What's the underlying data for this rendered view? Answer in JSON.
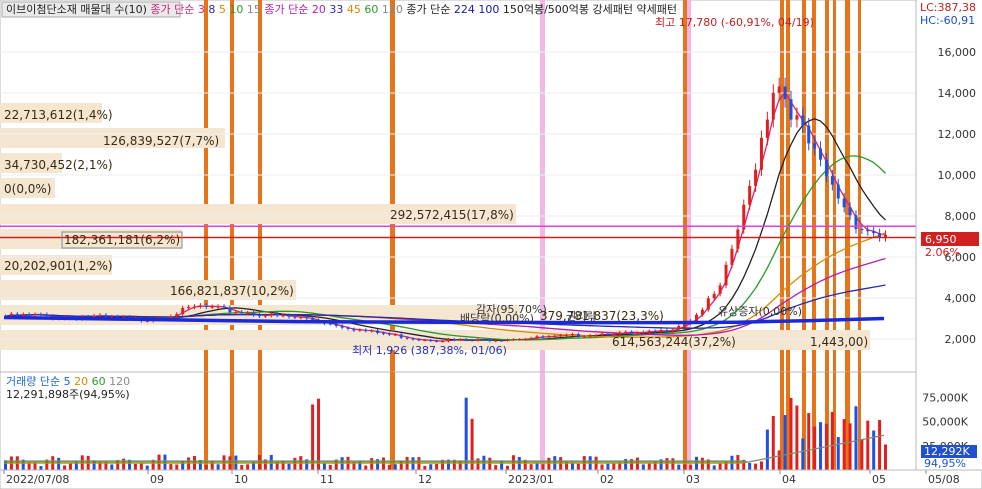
{
  "legend_price": [
    {
      "text": "이브이첨단소재 매물대 수(10)",
      "color": "#222222",
      "boxed": true
    },
    {
      "text": "종가 단순",
      "color": "#d4237a"
    },
    {
      "text": "3",
      "color": "#d4237a"
    },
    {
      "text": "8",
      "color": "#2a2aa8"
    },
    {
      "text": "5",
      "color": "#d88a00"
    },
    {
      "text": "10",
      "color": "#2a9a2a"
    },
    {
      "text": "15",
      "color": "#888888"
    },
    {
      "text": "종가 단순",
      "color": "#b020b0"
    },
    {
      "text": "20",
      "color": "#b020b0"
    },
    {
      "text": "33",
      "color": "#2a2aa8"
    },
    {
      "text": "45",
      "color": "#d88a00"
    },
    {
      "text": "60",
      "color": "#2a9a2a"
    },
    {
      "text": "120",
      "color": "#888888"
    },
    {
      "text": "종가 단순",
      "color": "#222222"
    },
    {
      "text": "224",
      "color": "#1a1aa0"
    },
    {
      "text": "100",
      "color": "#1a1aa0"
    },
    {
      "text": "150억봉/500억봉 강세패턴",
      "color": "#222222"
    },
    {
      "text": "약세패턴",
      "color": "#222222"
    }
  ],
  "legend_volume": [
    {
      "text": "거래량 단순",
      "color": "#1a6ad0"
    },
    {
      "text": "5",
      "color": "#1a6ad0"
    },
    {
      "text": "20",
      "color": "#d88a00"
    },
    {
      "text": "60",
      "color": "#2a9a2a"
    },
    {
      "text": "120",
      "color": "#888888"
    }
  ],
  "volume_readout": "12,291,898주(94,95%)",
  "top_right": {
    "lc": "LC:387,38",
    "hc": "HC:-60,91"
  },
  "current_price": {
    "value": 6950,
    "label": "6,950",
    "change": "2.06%"
  },
  "volume_current": {
    "label": "12,292K",
    "pct": "94,95%"
  },
  "colors": {
    "rise": "#e02020",
    "fall": "#2050e0",
    "ma224": "#1a2ad8",
    "highlight": "#e8741a",
    "highlight_pink": "#f0b8e6",
    "band": "#f5e6d2",
    "magenta_line": "#e040e0",
    "red_line": "#cc2020"
  },
  "chart_data": {
    "type": "candlestick",
    "x_ticks": [
      "2022/07/08",
      "09",
      "10",
      "11",
      "12",
      "2023/01",
      "02",
      "03",
      "04",
      "05",
      "05/08"
    ],
    "y_ticks": [
      2000,
      4000,
      6000,
      8000,
      10000,
      12000,
      14000,
      16000
    ],
    "y_tick_labels": [
      "2,000",
      "4,000",
      "6,000",
      "8,000",
      "10,000",
      "12,000",
      "14,000",
      "16,000"
    ],
    "volume_y_ticks": [
      25000,
      50000,
      75000
    ],
    "volume_y_tick_labels": [
      "25,000K",
      "50,000K",
      "75,000K"
    ],
    "volume_profile": [
      {
        "label": "22,713,612(1,4%)",
        "level": "22,713,612(1,4%)"
      },
      {
        "label": "126,839,527(7,7%)"
      },
      {
        "label": "34,730,452(2,1%)"
      },
      {
        "label": "0(0,0%)"
      },
      {
        "label": "292,572,415(17,8%)"
      },
      {
        "label": "182,361,181(6,2%)",
        "boxed": true
      },
      {
        "label": "20,202,901(1,2%)"
      },
      {
        "label": "166,821,837(10,2%)"
      },
      {
        "label": "379,781,837(23,3%)"
      },
      {
        "label": "614,563,244(37,2%)"
      },
      {
        "label": "1,443,00)"
      }
    ],
    "annotations": {
      "high": "최고 17,780 (-60,91%, 04/19)",
      "low": "최저 1,926 (387,38%, 01/06)",
      "capital_reduction": "감자(95,70%)",
      "ex_rights": "배당락(0,00%)",
      "rights_issue_a": "권리락",
      "rights_issue": "유상증자(0,00%)"
    },
    "horizontal_levels": [
      7500,
      6950
    ],
    "price_path": [
      3100,
      3150,
      3050,
      3100,
      3000,
      2950,
      3200,
      3600,
      3400,
      3250,
      3100,
      3000,
      2700,
      2400,
      2200,
      2000,
      1950,
      1926,
      2000,
      2050,
      2100,
      2200,
      2300,
      2250,
      2400,
      3000,
      4500,
      9000,
      14800,
      12000,
      9500,
      7500,
      6950
    ],
    "ma224": [
      3050,
      3000,
      2950,
      2900,
      2850,
      2830,
      2820,
      2810,
      2800,
      2800,
      2820,
      2900,
      3000
    ]
  }
}
